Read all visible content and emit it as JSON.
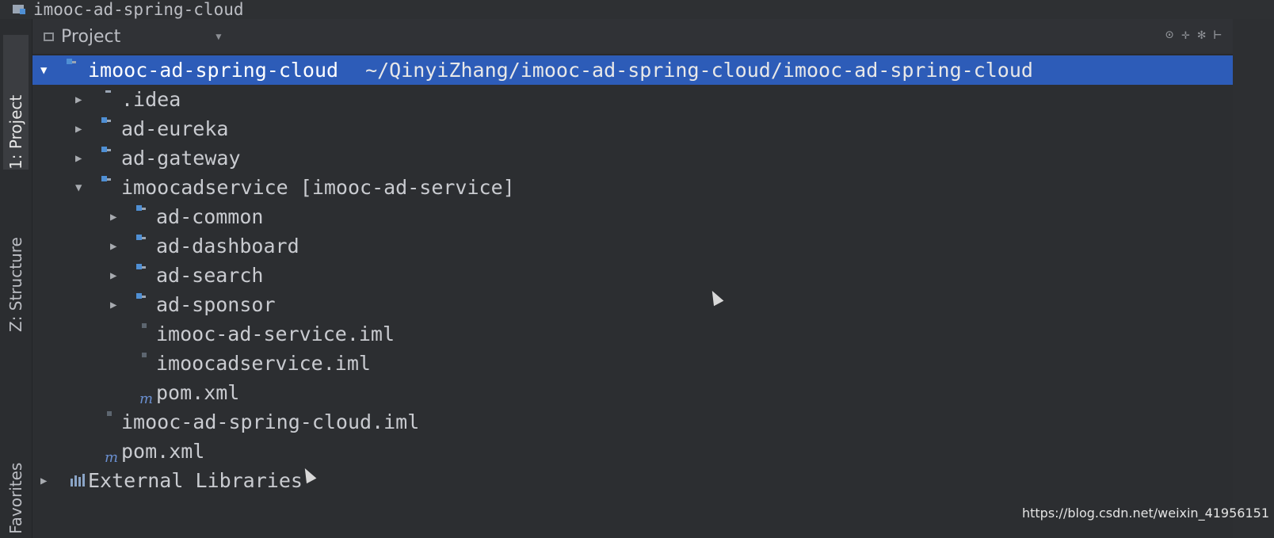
{
  "window": {
    "title": "imooc-ad-spring-cloud"
  },
  "left_tabs": [
    {
      "label": "1: Project",
      "active": true
    },
    {
      "label": "Z: Structure",
      "active": false
    },
    {
      "label": "Favorites",
      "active": false
    }
  ],
  "panel": {
    "title": "Project"
  },
  "tree": {
    "root": {
      "label": "imooc-ad-spring-cloud",
      "path": "~/QinyiZhang/imooc-ad-spring-cloud/imooc-ad-spring-cloud"
    },
    "idea": ".idea",
    "ad_eureka": "ad-eureka",
    "ad_gateway": "ad-gateway",
    "imoocadservice": "imoocadservice [imooc-ad-service]",
    "ad_common": "ad-common",
    "ad_dashboard": "ad-dashboard",
    "ad_search": "ad-search",
    "ad_sponsor": "ad-sponsor",
    "svc_iml_1": "imooc-ad-service.iml",
    "svc_iml_2": "imoocadservice.iml",
    "svc_pom": "pom.xml",
    "root_iml": "imooc-ad-spring-cloud.iml",
    "root_pom": "pom.xml",
    "external_libraries": "External Libraries"
  },
  "watermark": "https://blog.csdn.net/weixin_41956151",
  "colors": {
    "selection": "#2d5cb8",
    "background": "#2c2e31"
  },
  "icons": {
    "folder": "folder-icon",
    "module": "module-folder-icon",
    "iml": "iml-file-icon",
    "maven": "maven-pom-icon",
    "libraries": "libraries-icon"
  }
}
